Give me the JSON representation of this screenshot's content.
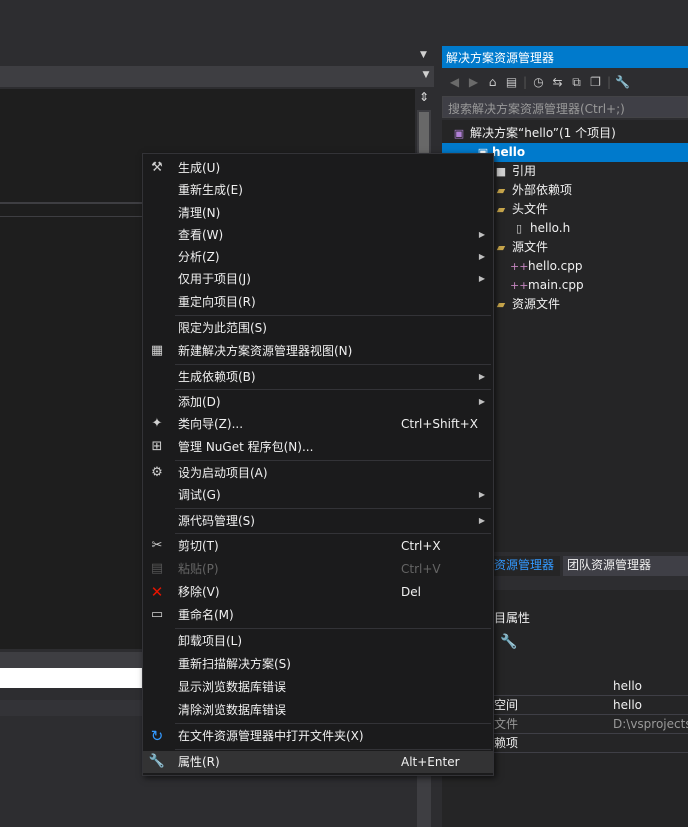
{
  "solution_explorer": {
    "title": "解决方案资源管理器",
    "search_placeholder": "搜索解决方案资源管理器(Ctrl+;)",
    "toolbar_icons": [
      "back-icon",
      "forward-icon",
      "home-icon",
      "switch-views-icon",
      "history-icon",
      "sync-icon",
      "collapse-all-icon",
      "show-all-files-icon",
      "properties-wrench-icon"
    ],
    "tree": [
      {
        "label": "解决方案“hello”(1 个项目)",
        "icon": "solution-icon"
      },
      {
        "label": "hello",
        "icon": "project-icon",
        "selected": true
      },
      {
        "label": "引用",
        "icon": "references-icon"
      },
      {
        "label": "外部依赖项",
        "icon": "folder-icon"
      },
      {
        "label": "头文件",
        "icon": "folder-icon"
      },
      {
        "label": "hello.h",
        "icon": "header-file-icon"
      },
      {
        "label": "源文件",
        "icon": "folder-icon"
      },
      {
        "label": "hello.cpp",
        "icon": "cpp-file-icon"
      },
      {
        "label": "main.cpp",
        "icon": "cpp-file-icon"
      },
      {
        "label": "资源文件",
        "icon": "folder-icon"
      }
    ],
    "tabs": [
      {
        "label": "资源管理器",
        "active": true
      },
      {
        "label": "团队资源管理器",
        "active": false
      }
    ]
  },
  "properties": {
    "title": "目属性",
    "rows": [
      {
        "key": "",
        "value": "hello"
      },
      {
        "key": "空间",
        "value": "hello"
      },
      {
        "key": "文件",
        "value": "D:\\vsprojects"
      },
      {
        "key": "赖项",
        "value": ""
      }
    ]
  },
  "context_menu": {
    "items": [
      {
        "label": "生成(U)",
        "icon": "build-icon"
      },
      {
        "label": "重新生成(E)"
      },
      {
        "label": "清理(N)"
      },
      {
        "label": "查看(W)",
        "submenu": true
      },
      {
        "label": "分析(Z)",
        "submenu": true
      },
      {
        "label": "仅用于项目(J)",
        "submenu": true
      },
      {
        "label": "重定向项目(R)"
      },
      {
        "label": "限定为此范围(S)"
      },
      {
        "label": "新建解决方案资源管理器视图(N)",
        "icon": "new-view-icon"
      },
      {
        "label": "生成依赖项(B)",
        "submenu": true
      },
      {
        "label": "添加(D)",
        "submenu": true
      },
      {
        "label": "类向导(Z)...",
        "shortcut": "Ctrl+Shift+X",
        "icon": "class-wizard-icon"
      },
      {
        "label": "管理 NuGet 程序包(N)...",
        "icon": "nuget-icon"
      },
      {
        "label": "设为启动项目(A)",
        "icon": "gear-icon"
      },
      {
        "label": "调试(G)",
        "submenu": true
      },
      {
        "label": "源代码管理(S)",
        "submenu": true
      },
      {
        "label": "剪切(T)",
        "shortcut": "Ctrl+X",
        "icon": "scissors-icon"
      },
      {
        "label": "粘贴(P)",
        "shortcut": "Ctrl+V",
        "icon": "paste-icon",
        "disabled": true
      },
      {
        "label": "移除(V)",
        "shortcut": "Del",
        "icon": "remove-x-icon"
      },
      {
        "label": "重命名(M)",
        "icon": "rename-icon"
      },
      {
        "label": "卸载项目(L)"
      },
      {
        "label": "重新扫描解决方案(S)"
      },
      {
        "label": "显示浏览数据库错误"
      },
      {
        "label": "清除浏览数据库错误"
      },
      {
        "label": "在文件资源管理器中打开文件夹(X)",
        "icon": "refresh-arrow-icon"
      },
      {
        "label": "属性(R)",
        "shortcut": "Alt+Enter",
        "icon": "wrench-icon",
        "hover": true
      }
    ]
  },
  "colors": {
    "accent": "#007acc",
    "menu_bg": "#1b1b1c",
    "remove_red": "#e51400",
    "open_folder_blue": "#3399ff"
  }
}
